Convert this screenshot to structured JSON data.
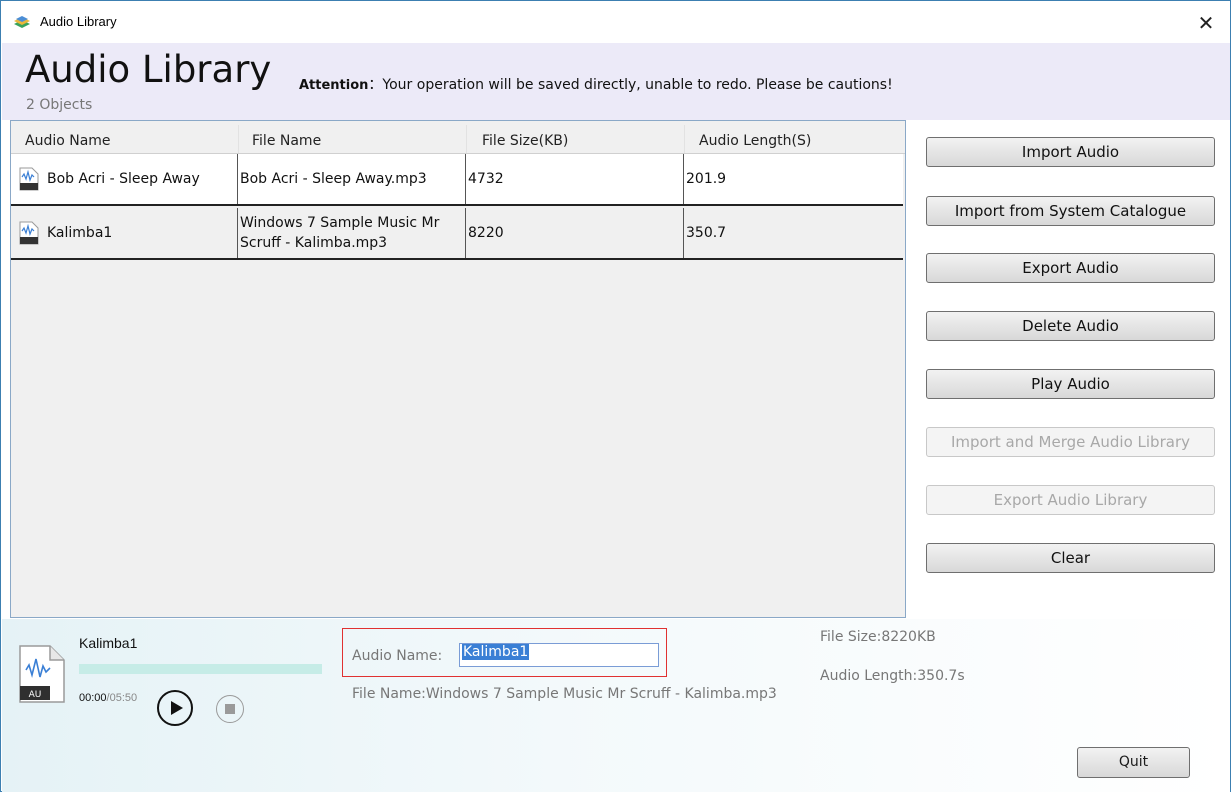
{
  "window": {
    "title": "Audio Library",
    "close_symbol": "✕"
  },
  "header": {
    "title": "Audio Library",
    "object_count": "2 Objects",
    "attention_label": "Attention",
    "attention_text": "：Your operation will be saved directly, unable to redo. Please be cautions!"
  },
  "table": {
    "columns": [
      "Audio Name",
      "File Name",
      "File Size(KB)",
      "Audio Length(S)"
    ],
    "rows": [
      {
        "icon": "audio-file-icon",
        "audio_name": "Bob Acri - Sleep Away",
        "file_name": "Bob Acri - Sleep Away.mp3",
        "file_size": "4732",
        "audio_length": "201.9"
      },
      {
        "icon": "audio-file-icon",
        "audio_name": "Kalimba1",
        "file_name": "Windows 7 Sample Music Mr Scruff - Kalimba.mp3",
        "file_size": "8220",
        "audio_length": "350.7"
      }
    ]
  },
  "buttons": {
    "import_audio": "Import Audio",
    "import_system": "Import from System Catalogue",
    "export_audio": "Export Audio",
    "delete_audio": "Delete Audio",
    "play_audio": "Play Audio",
    "import_merge": "Import and Merge Audio Library",
    "export_library": "Export Audio Library",
    "clear": "Clear",
    "quit": "Quit"
  },
  "player": {
    "title": "Kalimba1",
    "current_time": "00:00",
    "total_time": "/05:50",
    "progress": 0,
    "icon_label": "AU"
  },
  "details": {
    "audio_name_label": "Audio Name:",
    "audio_name_value": "Kalimba1",
    "file_name": "File Name:Windows 7 Sample Music Mr Scruff - Kalimba.mp3",
    "file_size": "File Size:8220KB",
    "audio_length": "Audio Length:350.7s"
  },
  "colors": {
    "header_bg": "#eceaf8",
    "selection": "#3a7fd5",
    "highlight_border": "#e03131",
    "progress_track": "#c6ece7"
  }
}
